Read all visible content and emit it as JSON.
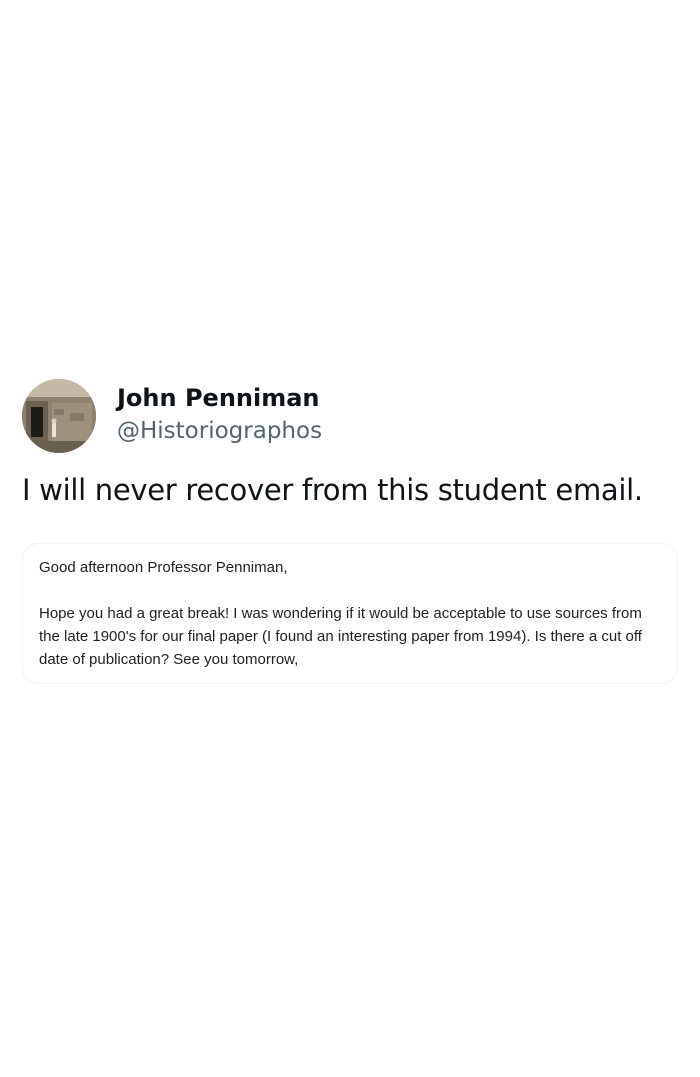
{
  "author": {
    "display_name": "John Penniman",
    "handle": "@Historiographos",
    "avatar_icon": "profile-photo"
  },
  "tweet": {
    "text": "I will never recover from this student email."
  },
  "email": {
    "greeting": "Good afternoon Professor Penniman,",
    "body": "Hope you had a great break! I was wondering if it would be acceptable to use sources from the late 1900's for our final paper (I found an interesting paper from 1994). Is there a cut off date of publication? See you tomorrow,"
  },
  "colors": {
    "text_primary": "#0f1419",
    "text_secondary": "#536471",
    "card_border": "#eff1f3",
    "background": "#ffffff"
  }
}
